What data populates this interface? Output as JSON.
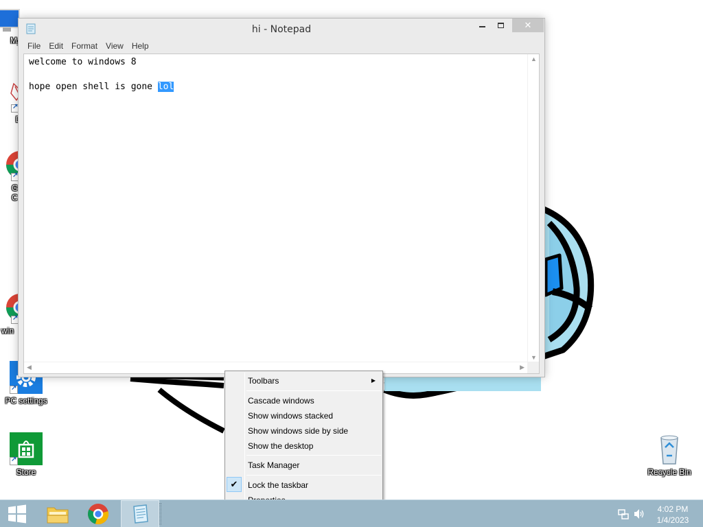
{
  "notepad": {
    "title": "hi - Notepad",
    "menu": [
      "File",
      "Edit",
      "Format",
      "View",
      "Help"
    ],
    "line1": "welcome to windows 8",
    "line2_prefix": "hope open shell is gone ",
    "line2_selected": "lol"
  },
  "desktop_icons": {
    "my_computer": "My C",
    "data": "Data",
    "chrome_line1": "G",
    "chrome_line2": "C",
    "win": "win",
    "pc_settings": "PC settings",
    "store": "Store",
    "recycle_bin": "Recycle Bin"
  },
  "context_menu": {
    "toolbars": "Toolbars",
    "cascade": "Cascade windows",
    "stacked": "Show windows stacked",
    "side_by_side": "Show windows side by side",
    "show_desktop": "Show the desktop",
    "task_manager": "Task Manager",
    "lock_taskbar": "Lock the taskbar",
    "lock_taskbar_checked": true,
    "properties": "Properties"
  },
  "taskbar": {
    "icons": [
      "windows-logo-icon",
      "file-explorer-icon",
      "chrome-icon",
      "notepad-icon"
    ],
    "active_app": "notepad",
    "time": "4:02 PM",
    "date": "1/4/2023"
  },
  "colors": {
    "taskbar": "#9bb7c7",
    "selection": "#3399ff",
    "wallpaper_fill": "#a9dff0",
    "wallpaper_accent": "#1b8ff0",
    "store_tile": "#0f9a37",
    "settings_tile": "#1a7de0"
  }
}
